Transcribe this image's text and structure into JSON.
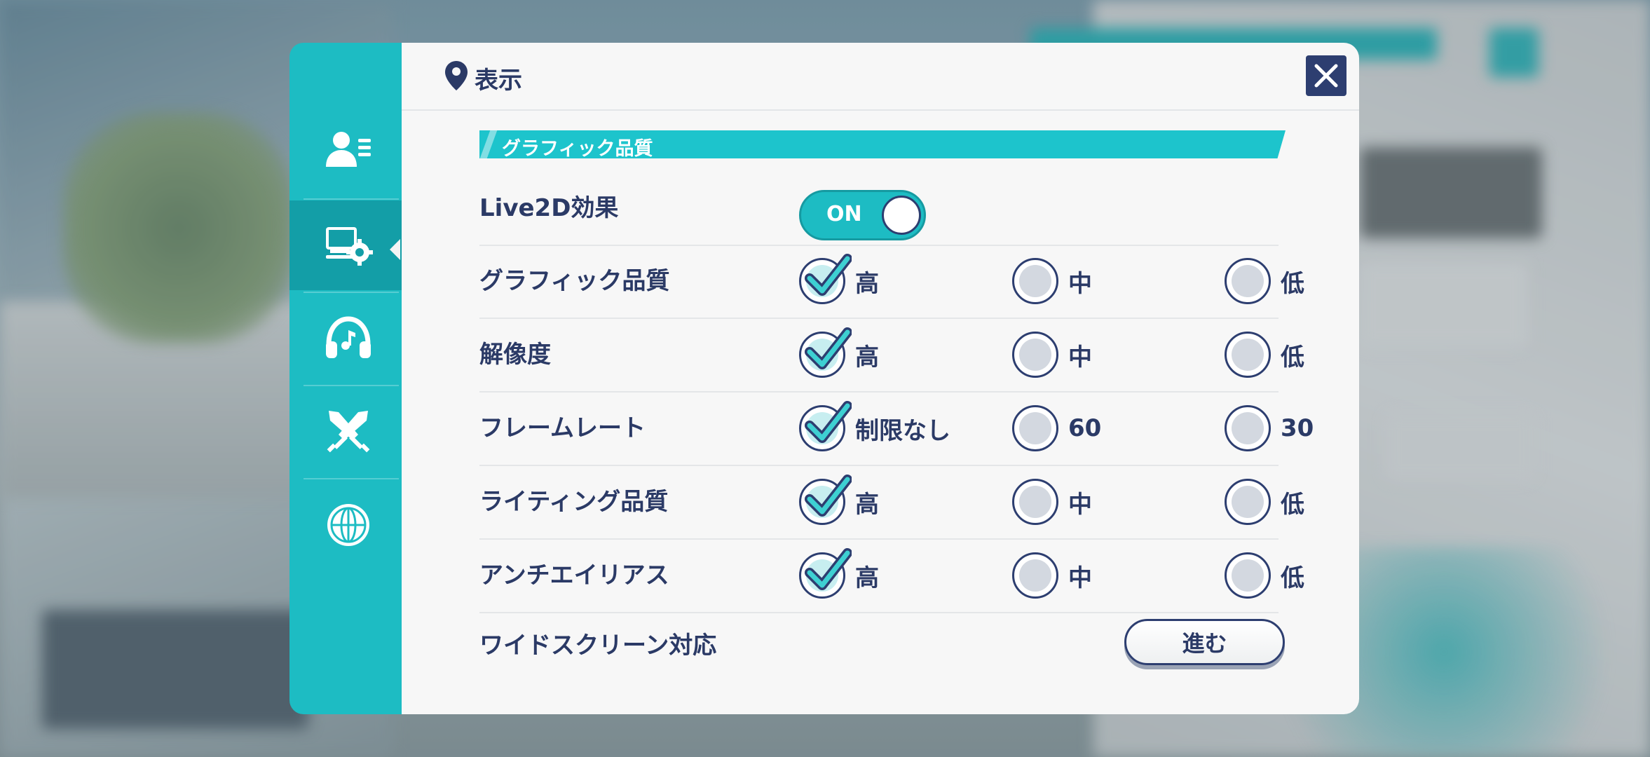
{
  "header": {
    "title": "表示"
  },
  "sidebar": {
    "items": [
      {
        "icon": "user-profile-icon",
        "active": false
      },
      {
        "icon": "display-settings-icon",
        "active": true
      },
      {
        "icon": "headphones-music-icon",
        "active": false
      },
      {
        "icon": "crossed-swords-icon",
        "active": false
      },
      {
        "icon": "globe-icon",
        "active": false
      }
    ]
  },
  "section": {
    "title": "グラフィック品質"
  },
  "live2d": {
    "label": "Live2D効果",
    "toggle_text": "ON",
    "state": "on"
  },
  "settings": [
    {
      "label": "グラフィック品質",
      "options": [
        "高",
        "中",
        "低"
      ],
      "selected": 0
    },
    {
      "label": "解像度",
      "options": [
        "高",
        "中",
        "低"
      ],
      "selected": 0
    },
    {
      "label": "フレームレート",
      "options": [
        "制限なし",
        "60",
        "30"
      ],
      "selected": 0
    },
    {
      "label": "ライティング品質",
      "options": [
        "高",
        "中",
        "低"
      ],
      "selected": 0
    },
    {
      "label": "アンチエイリアス",
      "options": [
        "高",
        "中",
        "低"
      ],
      "selected": 0
    }
  ],
  "widescreen": {
    "label": "ワイドスクリーン対応",
    "button_label": "進む"
  },
  "colors": {
    "accent": "#1dbcc3",
    "accent_dark": "#139ea7",
    "text": "#2b3a66",
    "panel": "#f7f7f7"
  }
}
